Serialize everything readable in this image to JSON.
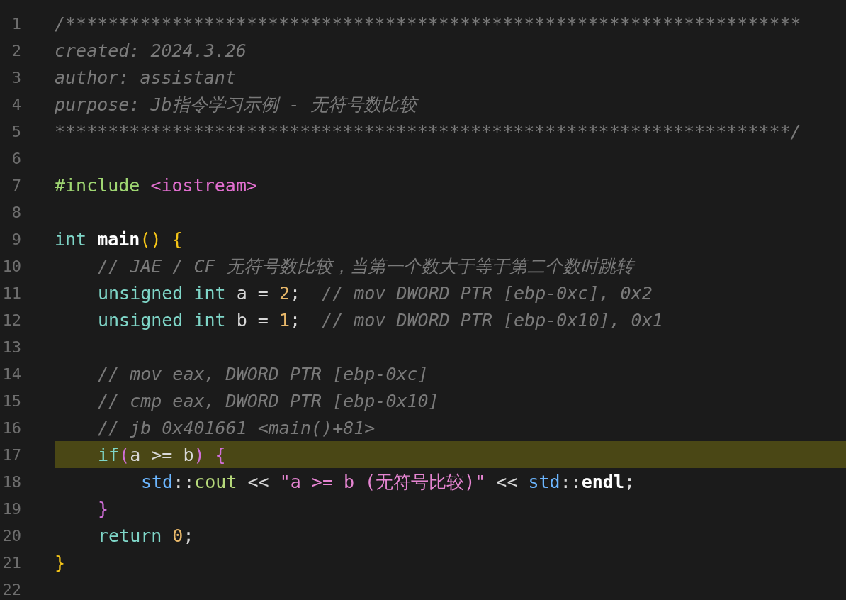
{
  "editor": {
    "lines": [
      {
        "number": "1",
        "highlighted": false,
        "tokens": [
          {
            "kind": "comment",
            "text": "/*********************************************************************"
          }
        ]
      },
      {
        "number": "2",
        "highlighted": false,
        "tokens": [
          {
            "kind": "comment",
            "text": "created: 2024.3.26"
          }
        ]
      },
      {
        "number": "3",
        "highlighted": false,
        "tokens": [
          {
            "kind": "comment",
            "text": "author: assistant"
          }
        ]
      },
      {
        "number": "4",
        "highlighted": false,
        "tokens": [
          {
            "kind": "comment",
            "text": "purpose: Jb指令学习示例 - 无符号数比较"
          }
        ]
      },
      {
        "number": "5",
        "highlighted": false,
        "tokens": [
          {
            "kind": "comment",
            "text": "*********************************************************************/"
          }
        ]
      },
      {
        "number": "6",
        "highlighted": false
      },
      {
        "number": "7",
        "highlighted": false,
        "tokens": [
          {
            "kind": "directive",
            "text": "#include "
          },
          {
            "kind": "header",
            "text": "<iostream>"
          }
        ]
      },
      {
        "number": "8",
        "highlighted": false
      },
      {
        "number": "9",
        "highlighted": false,
        "tokens": [
          {
            "kind": "type",
            "text": "int "
          },
          {
            "kind": "bold",
            "text": "main"
          },
          {
            "kind": "bracket1",
            "text": "() {"
          }
        ],
        "children": [
          {
            "number": "10",
            "highlighted": false,
            "tokens": [
              {
                "kind": "comment",
                "text": "// JAE / CF 无符号数比较，当第一个数大于等于第二个数时跳转"
              }
            ]
          },
          {
            "number": "11",
            "highlighted": false,
            "tokens": [
              {
                "kind": "type",
                "text": "unsigned int"
              },
              {
                "kind": "plain",
                "text": " a = "
              },
              {
                "kind": "number",
                "text": "2"
              },
              {
                "kind": "plain",
                "text": ";"
              },
              {
                "kind": "comment",
                "text": "  // mov DWORD PTR [ebp-0xc], 0x2"
              }
            ]
          },
          {
            "number": "12",
            "highlighted": false,
            "tokens": [
              {
                "kind": "type",
                "text": "unsigned int"
              },
              {
                "kind": "plain",
                "text": " b = "
              },
              {
                "kind": "number",
                "text": "1"
              },
              {
                "kind": "plain",
                "text": ";"
              },
              {
                "kind": "comment",
                "text": "  // mov DWORD PTR [ebp-0x10], 0x1"
              }
            ]
          },
          {
            "number": "13",
            "highlighted": false
          },
          {
            "number": "14",
            "highlighted": false,
            "tokens": [
              {
                "kind": "comment",
                "text": "// mov eax, DWORD PTR [ebp-0xc]"
              }
            ]
          },
          {
            "number": "15",
            "highlighted": false,
            "tokens": [
              {
                "kind": "comment",
                "text": "// cmp eax, DWORD PTR [ebp-0x10]"
              }
            ]
          },
          {
            "number": "16",
            "highlighted": false,
            "tokens": [
              {
                "kind": "comment",
                "text": "// jb 0x401661 <main()+81>"
              }
            ]
          },
          {
            "number": "17",
            "highlighted": true,
            "tokens": [
              {
                "kind": "keyword",
                "text": "if"
              },
              {
                "kind": "bracket2",
                "text": "("
              },
              {
                "kind": "plain",
                "text": "a >= b"
              },
              {
                "kind": "bracket2",
                "text": ") {"
              }
            ],
            "children": [
              {
                "number": "18",
                "highlighted": false,
                "tokens": [
                  {
                    "kind": "namespace",
                    "text": "std"
                  },
                  {
                    "kind": "plain",
                    "text": "::"
                  },
                  {
                    "kind": "member",
                    "text": "cout"
                  },
                  {
                    "kind": "plain",
                    "text": " << "
                  },
                  {
                    "kind": "string",
                    "text": "\"a >= b (无符号比较)\""
                  },
                  {
                    "kind": "plain",
                    "text": " << "
                  },
                  {
                    "kind": "namespace",
                    "text": "std"
                  },
                  {
                    "kind": "plain",
                    "text": "::"
                  },
                  {
                    "kind": "bold",
                    "text": "endl"
                  },
                  {
                    "kind": "plain",
                    "text": ";"
                  }
                ]
              }
            ]
          },
          {
            "number": "19",
            "highlighted": false,
            "tokens": [
              {
                "kind": "bracket2",
                "text": "}"
              }
            ]
          },
          {
            "number": "20",
            "highlighted": false,
            "tokens": [
              {
                "kind": "keyword",
                "text": "return "
              },
              {
                "kind": "number",
                "text": "0"
              },
              {
                "kind": "plain",
                "text": ";"
              }
            ]
          }
        ]
      },
      {
        "number": "21",
        "highlighted": false,
        "tokens": [
          {
            "kind": "bracket1",
            "text": "}"
          }
        ]
      },
      {
        "number": "22",
        "highlighted": false
      }
    ]
  }
}
